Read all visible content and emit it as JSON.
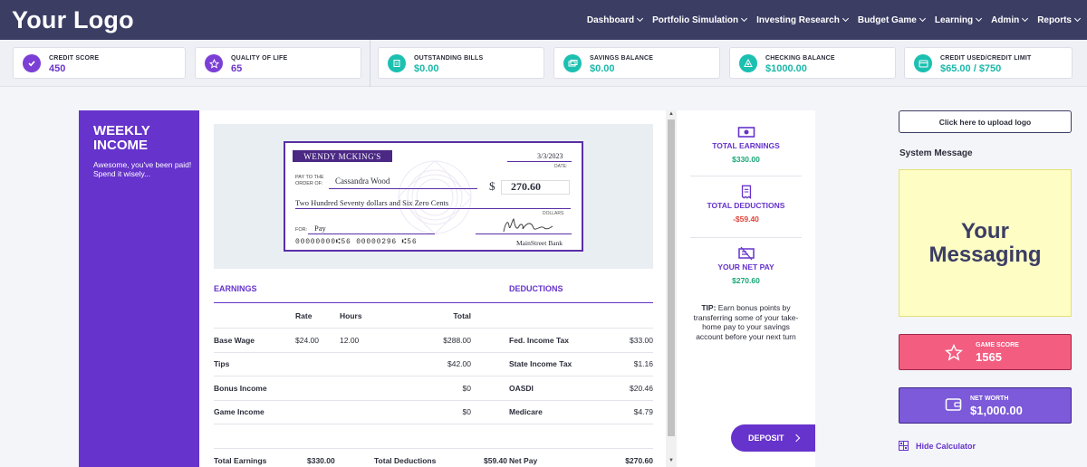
{
  "header": {
    "logo": "Your Logo",
    "nav": [
      "Dashboard",
      "Portfolio Simulation",
      "Investing Research",
      "Budget Game",
      "Learning",
      "Admin",
      "Reports"
    ]
  },
  "stats": [
    {
      "label": "CREDIT SCORE",
      "value": "450",
      "icon": "check-badge-icon"
    },
    {
      "label": "QUALITY OF LIFE",
      "value": "65",
      "icon": "star-badge-icon"
    },
    {
      "label": "OUTSTANDING BILLS",
      "value": "$0.00",
      "icon": "bill-icon"
    },
    {
      "label": "SAVINGS BALANCE",
      "value": "$0.00",
      "icon": "savings-icon"
    },
    {
      "label": "CHECKING BALANCE",
      "value": "$1000.00",
      "icon": "checking-icon"
    },
    {
      "label": "CREDIT USED/CREDIT LIMIT",
      "value": "$65.00 / $750",
      "icon": "credit-card-icon"
    }
  ],
  "income": {
    "title_line1": "WEEKLY",
    "title_line2": "INCOME",
    "subtitle": "Awesome, you've been paid! Spend it wisely..."
  },
  "check": {
    "payer": "WENDY MCKING'S",
    "date": "3/3/2023",
    "date_label": "DATE:",
    "pay_label_line1": "PAY TO THE",
    "pay_label_line2": "ORDER OF:",
    "payee": "Cassandra Wood",
    "dollar_sign": "$",
    "amount": "270.60",
    "amount_words": "Two Hundred Seventy dollars and Six Zero Cents",
    "dollars_label": "DOLLARS",
    "for_label": "FOR:",
    "memo": "Pay",
    "micr": "00000000⑆56   00000296 ⑆56",
    "bank": "MainStreet Bank"
  },
  "earnings": {
    "heading": "EARNINGS",
    "col_rate": "Rate",
    "col_hours": "Hours",
    "col_total": "Total",
    "rows": [
      {
        "name": "Base Wage",
        "rate": "$24.00",
        "hours": "12.00",
        "total": "$288.00"
      },
      {
        "name": "Tips",
        "rate": "",
        "hours": "",
        "total": "$42.00"
      },
      {
        "name": "Bonus Income",
        "rate": "",
        "hours": "",
        "total": "$0"
      },
      {
        "name": "Game Income",
        "rate": "",
        "hours": "",
        "total": "$0"
      }
    ]
  },
  "deductions": {
    "heading": "DEDUCTIONS",
    "rows": [
      {
        "name": "Fed. Income Tax",
        "amount": "$33.00"
      },
      {
        "name": "State Income Tax",
        "amount": "$1.16"
      },
      {
        "name": "OASDI",
        "amount": "$20.46"
      },
      {
        "name": "Medicare",
        "amount": "$4.79"
      }
    ]
  },
  "totals": {
    "earnings_label": "Total Earnings",
    "earnings_value": "$330.00",
    "deductions_label": "Total Deductions",
    "deductions_value": "$59.40",
    "net_label": "Net Pay",
    "net_value": "$270.60"
  },
  "summary": {
    "total_earnings_label": "TOTAL EARNINGS",
    "total_earnings_value": "$330.00",
    "total_deductions_label": "TOTAL DEDUCTIONS",
    "total_deductions_value": "-$59.40",
    "net_pay_label": "YOUR NET PAY",
    "net_pay_value": "$270.60",
    "tip_label": "TIP:",
    "tip_text": " Earn bonus points by transferring some of your take-home pay to your savings account before your next turn",
    "deposit": "DEPOSIT"
  },
  "sidebar": {
    "upload": "Click here to upload logo",
    "system_message_title": "System Message",
    "message": "Your Messaging",
    "game_score_label": "GAME SCORE",
    "game_score_value": "1565",
    "net_worth_label": "NET WORTH",
    "net_worth_value": "$1,000.00",
    "calculator": "Hide Calculator"
  },
  "colors": {
    "nav_bg": "#3b3d63",
    "accent_purple": "#6633cc",
    "teal": "#1cc0b0",
    "earnings_green": "#19a974",
    "deductions_red": "#e0433a",
    "score_pink": "#f35d80",
    "networth_purple": "#7c5ad9",
    "message_yellow": "#fdfdc4"
  }
}
